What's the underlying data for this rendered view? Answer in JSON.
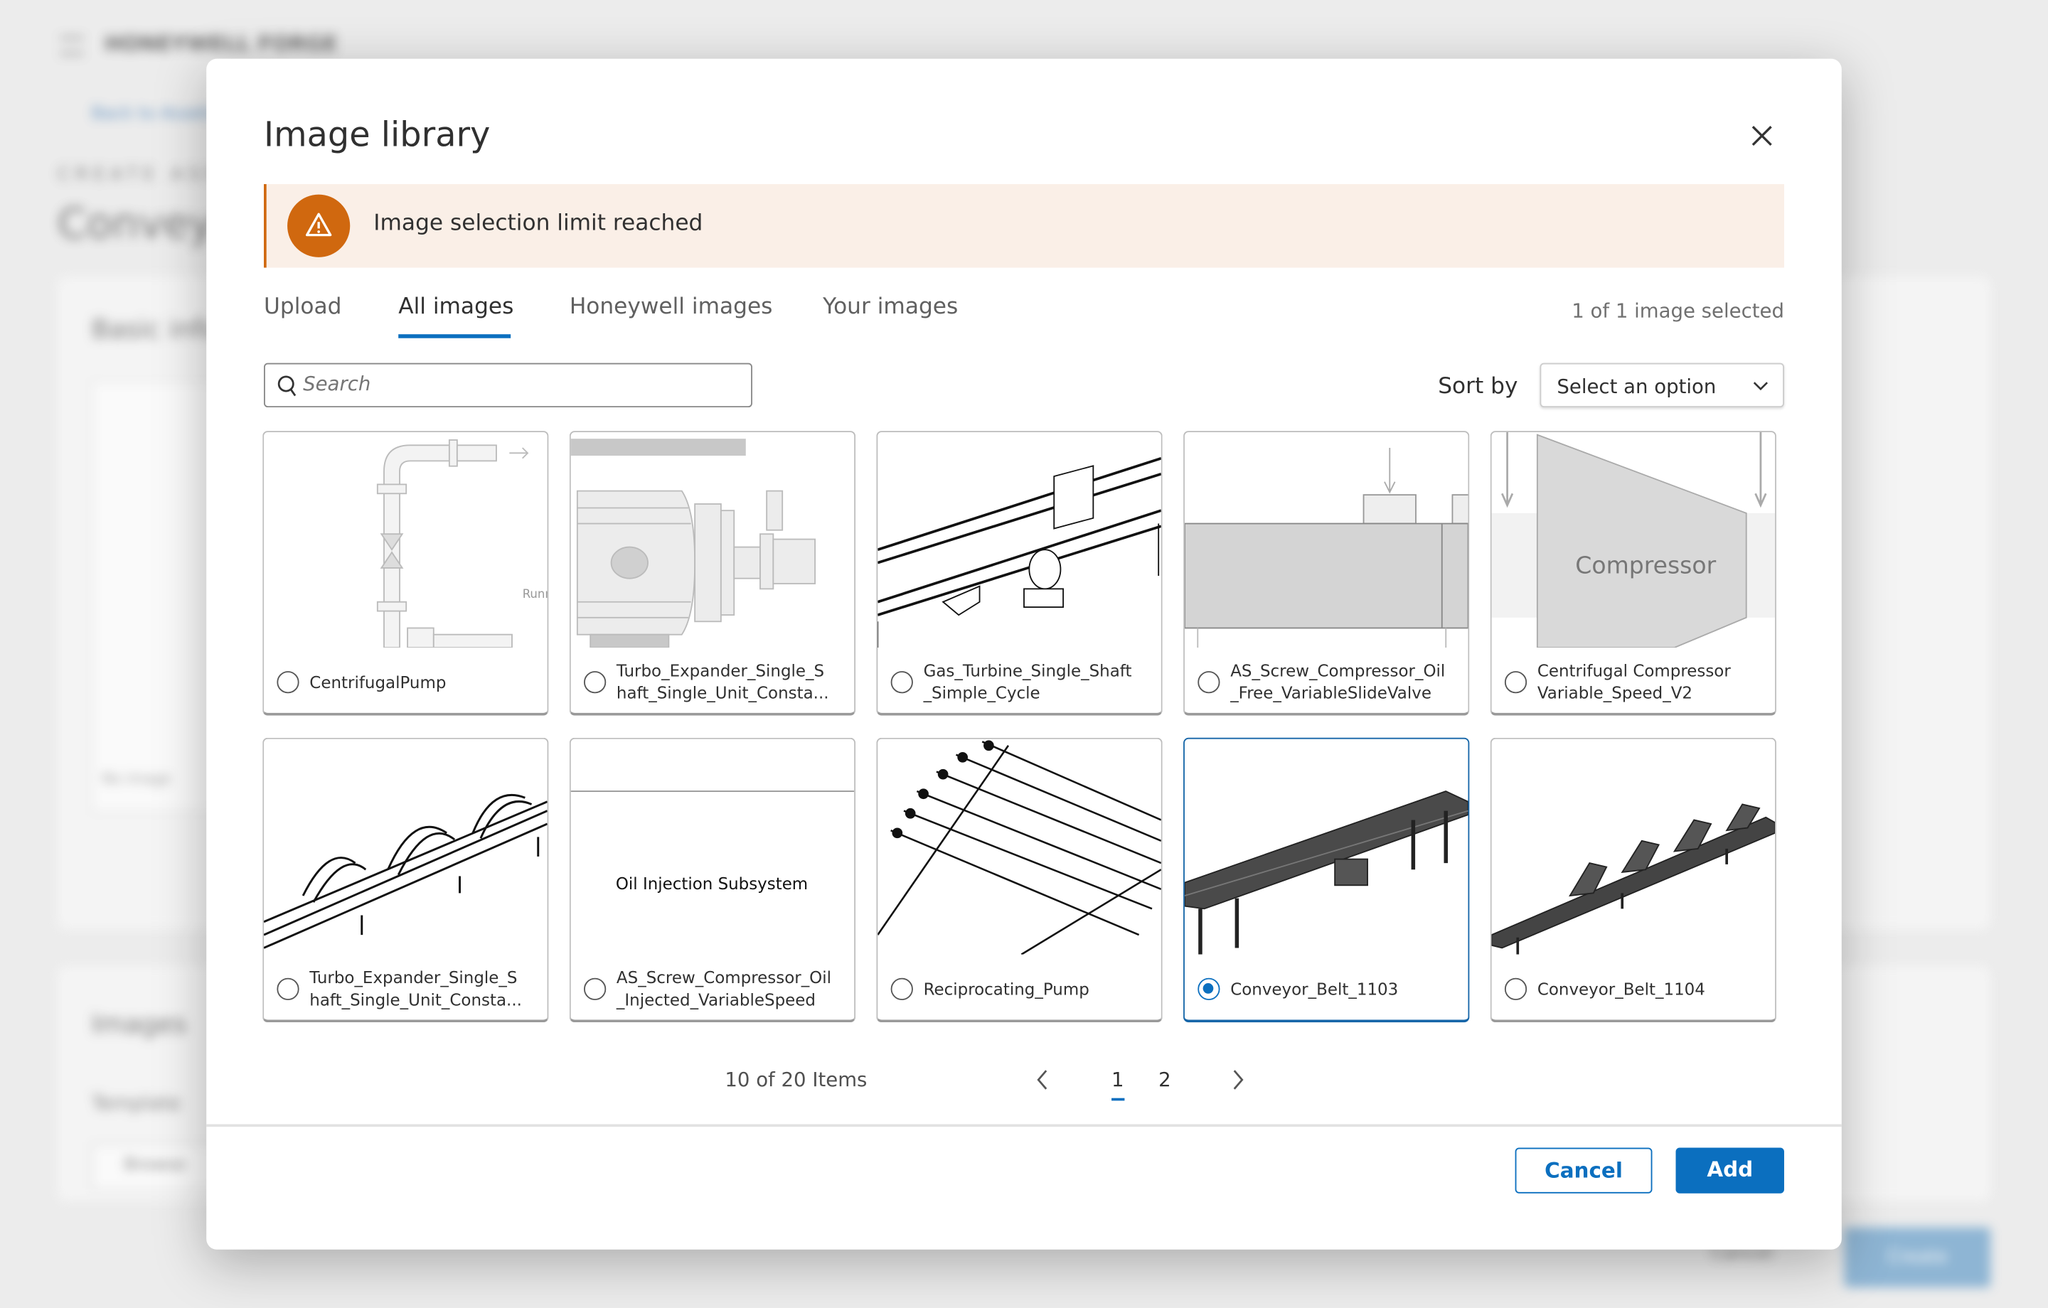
{
  "background": {
    "brand": "HONEYWELL FORGE",
    "back_link": "Back to Assets",
    "section": "CREATE ASSET",
    "page_title": "Conveyor",
    "card_title": "Basic info",
    "images_title": "Images",
    "template_label": "Template",
    "browse": "Browse",
    "no_image": "No image",
    "create_button": "Create",
    "cancel_button": "Cancel"
  },
  "dialog": {
    "title": "Image library",
    "close_icon": "close-icon",
    "alert": {
      "icon": "warning-icon",
      "message": "Image selection limit reached",
      "color": "#d0680f",
      "background": "#faefe7"
    },
    "tabs": [
      {
        "label": "Upload"
      },
      {
        "label": "All images",
        "active": true
      },
      {
        "label": "Honeywell images"
      },
      {
        "label": "Your images"
      }
    ],
    "selection_count": "1 of 1 image selected",
    "search": {
      "placeholder": "Search",
      "value": ""
    },
    "sort": {
      "label": "Sort by",
      "selected": "Select an option"
    },
    "images": [
      {
        "label": "CentrifugalPump",
        "selected": false
      },
      {
        "label": "Turbo_Expander_Single_S\nhaft_Single_Unit_Consta...",
        "selected": false
      },
      {
        "label": "Gas_Turbine_Single_Shaft\n_Simple_Cycle",
        "selected": false
      },
      {
        "label": "AS_Screw_Compressor_Oil\n_Free_VariableSlideValve",
        "selected": false
      },
      {
        "label": "Centrifugal Compressor\nVariable_Speed_V2",
        "selected": false,
        "thumb_text": "Compressor"
      },
      {
        "label": "Turbo_Expander_Single_S\nhaft_Single_Unit_Consta...",
        "selected": false
      },
      {
        "label": "AS_Screw_Compressor_Oil\n_Injected_VariableSpeed",
        "selected": false,
        "thumb_text": "Oil Injection Subsystem"
      },
      {
        "label": "Reciprocating_Pump",
        "selected": false
      },
      {
        "label": "Conveyor_Belt_1103",
        "selected": true
      },
      {
        "label": "Conveyor_Belt_1104",
        "selected": false
      }
    ],
    "thumb_extra": {
      "pump_text": "Runn"
    },
    "pagination": {
      "summary": "10 of 20 Items",
      "pages": [
        "1",
        "2"
      ],
      "current": "1"
    },
    "footer": {
      "cancel": "Cancel",
      "add": "Add"
    },
    "accent": "#0b6fbf"
  }
}
